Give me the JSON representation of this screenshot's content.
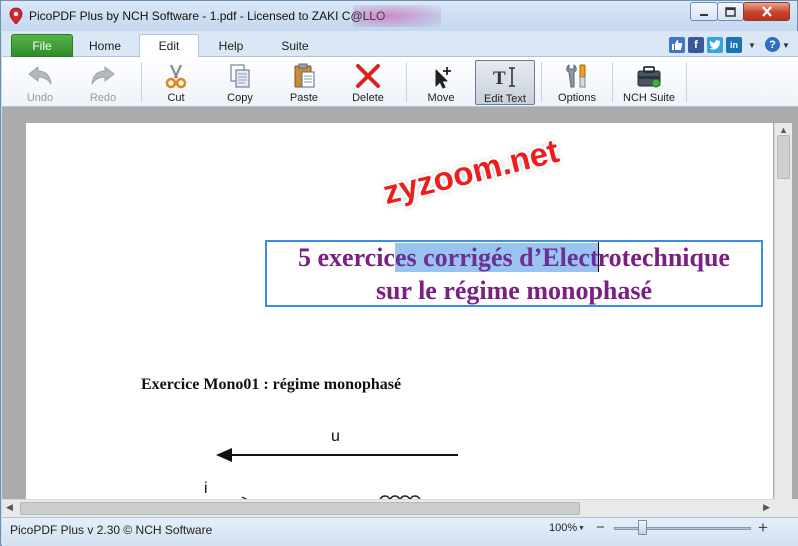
{
  "window": {
    "title": "PicoPDF Plus by NCH Software - 1.pdf - Licensed to ZAKI C@LLO"
  },
  "tabs": [
    {
      "label": "File"
    },
    {
      "label": "Home"
    },
    {
      "label": "Edit"
    },
    {
      "label": "Help"
    },
    {
      "label": "Suite"
    }
  ],
  "social": {
    "facebook": "f",
    "linkedin": "in",
    "help": "?"
  },
  "toolbar": [
    {
      "label": "Undo",
      "icon": "undo-icon",
      "enabled": false
    },
    {
      "label": "Redo",
      "icon": "redo-icon",
      "enabled": false
    },
    {
      "label": "Cut",
      "icon": "scissors-icon",
      "enabled": true
    },
    {
      "label": "Copy",
      "icon": "copy-icon",
      "enabled": true
    },
    {
      "label": "Paste",
      "icon": "paste-icon",
      "enabled": true
    },
    {
      "label": "Delete",
      "icon": "delete-x-icon",
      "enabled": true
    },
    {
      "label": "Move",
      "icon": "move-cursor-icon",
      "enabled": true
    },
    {
      "label": "Edit Text",
      "icon": "edit-text-icon",
      "enabled": true,
      "active": true
    },
    {
      "label": "Options",
      "icon": "wrench-icon",
      "enabled": true
    },
    {
      "label": "NCH Suite",
      "icon": "toolbox-icon",
      "enabled": true
    }
  ],
  "document": {
    "watermark": "zyzoom.net",
    "title_line1": {
      "before": "5 exercic",
      "selected": "es corrigés d’Elect",
      "after": "rotechnique"
    },
    "title_line2": "sur le régime monophasé",
    "exercise_heading": "Exercice Mono01 : régime monophasé",
    "label_u": "u",
    "label_i": "i",
    "title_color": "#7b1f83",
    "selection_color": "#99c4f2"
  },
  "statusbar": {
    "text": "PicoPDF Plus v 2.30 © NCH Software",
    "zoom": "100%",
    "zoom_fraction": 0.18,
    "minus": "−",
    "plus": "+"
  }
}
